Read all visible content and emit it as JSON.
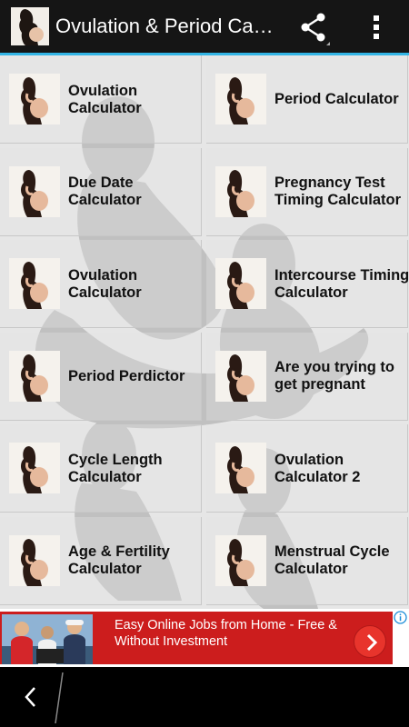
{
  "actionbar": {
    "title": "Ovulation & Period Cal…"
  },
  "tiles": [
    {
      "label": "Ovulation Calculator"
    },
    {
      "label": "Period Calculator"
    },
    {
      "label": "Due Date Calculator"
    },
    {
      "label": "Pregnancy Test Timing Calculator"
    },
    {
      "label": "Ovulation Calculator"
    },
    {
      "label": "Intercourse Timing Calculator"
    },
    {
      "label": "Period Perdictor"
    },
    {
      "label": "Are you trying to get pregnant"
    },
    {
      "label": "Cycle Length Calculator"
    },
    {
      "label": "Ovulation Calculator 2"
    },
    {
      "label": "Age & Fertility Calculator"
    },
    {
      "label": "Menstrual Cycle Calculator"
    }
  ],
  "ad": {
    "text": "Easy Online Jobs from Home - Free & Without Investment"
  },
  "colors": {
    "actionbar_bg": "#151515",
    "accent": "#33b5e5",
    "ad_bg": "#cc1d1d"
  },
  "icons": {
    "share": "share-icon",
    "overflow": "overflow-menu-icon",
    "back": "back-icon",
    "ad_next": "chevron-right-icon",
    "ad_info": "info-icon"
  }
}
